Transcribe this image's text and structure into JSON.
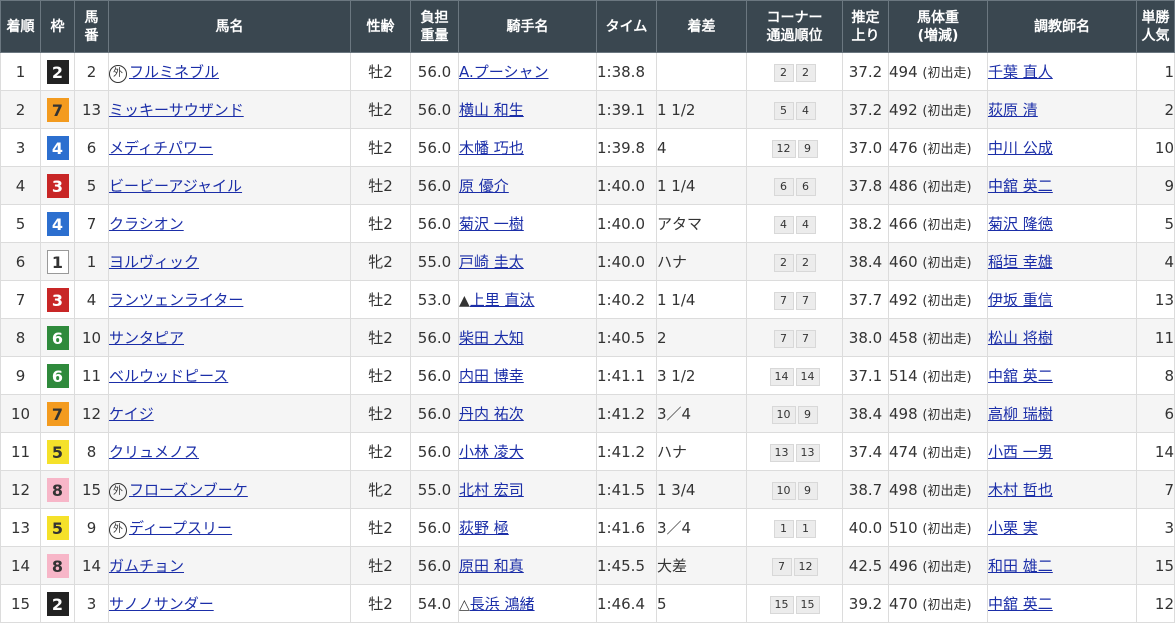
{
  "colors": {
    "header_bg": "#3a4750",
    "link": "#1b2ea8",
    "waku": {
      "1": {
        "bg": "#ffffff",
        "fg": "#333333",
        "border": "#999999"
      },
      "2": {
        "bg": "#222222",
        "fg": "#ffffff",
        "border": "#222222"
      },
      "3": {
        "bg": "#c82626",
        "fg": "#ffffff",
        "border": "#c82626"
      },
      "4": {
        "bg": "#2c6fcf",
        "fg": "#ffffff",
        "border": "#2c6fcf"
      },
      "5": {
        "bg": "#f5e12a",
        "fg": "#333333",
        "border": "#f5e12a"
      },
      "6": {
        "bg": "#2f8a3c",
        "fg": "#ffffff",
        "border": "#2f8a3c"
      },
      "7": {
        "bg": "#f39b1f",
        "fg": "#333333",
        "border": "#f39b1f"
      },
      "8": {
        "bg": "#f7b6c8",
        "fg": "#333333",
        "border": "#f7b6c8"
      }
    }
  },
  "headers": {
    "rank": "着順",
    "waku": "枠",
    "umaban": "馬\n番",
    "horse": "馬名",
    "sex_age": "性齢",
    "weight": "負担\n重量",
    "jockey": "騎手名",
    "time": "タイム",
    "margin": "着差",
    "corner": "コーナー\n通過順位",
    "last3f": "推定\n上り",
    "body_weight": "馬体重\n(増減)",
    "trainer": "調教師名",
    "popularity": "単勝\n人気"
  },
  "rows": [
    {
      "rank": "1",
      "waku": "2",
      "umaban": "2",
      "foreign": true,
      "horse": "フルミネブル",
      "sex_age": "牡2",
      "weight": "56.0",
      "jockey_mark": "",
      "jockey": "A.プーシャン",
      "time": "1:38.8",
      "margin": "",
      "corner": [
        "2",
        "2"
      ],
      "last3f": "37.2",
      "body_weight": "494",
      "weight_diff": "(初出走)",
      "trainer": "千葉 直人",
      "popularity": "1"
    },
    {
      "rank": "2",
      "waku": "7",
      "umaban": "13",
      "foreign": false,
      "horse": "ミッキーサウザンド",
      "sex_age": "牡2",
      "weight": "56.0",
      "jockey_mark": "",
      "jockey": "横山 和生",
      "time": "1:39.1",
      "margin": "1 1/2",
      "corner": [
        "5",
        "4"
      ],
      "last3f": "37.2",
      "body_weight": "492",
      "weight_diff": "(初出走)",
      "trainer": "荻原 清",
      "popularity": "2"
    },
    {
      "rank": "3",
      "waku": "4",
      "umaban": "6",
      "foreign": false,
      "horse": "メディチパワー",
      "sex_age": "牡2",
      "weight": "56.0",
      "jockey_mark": "",
      "jockey": "木幡 巧也",
      "time": "1:39.8",
      "margin": "4",
      "corner": [
        "12",
        "9"
      ],
      "last3f": "37.0",
      "body_weight": "476",
      "weight_diff": "(初出走)",
      "trainer": "中川 公成",
      "popularity": "10"
    },
    {
      "rank": "4",
      "waku": "3",
      "umaban": "5",
      "foreign": false,
      "horse": "ビービーアジャイル",
      "sex_age": "牡2",
      "weight": "56.0",
      "jockey_mark": "",
      "jockey": "原 優介",
      "time": "1:40.0",
      "margin": "1 1/4",
      "corner": [
        "6",
        "6"
      ],
      "last3f": "37.8",
      "body_weight": "486",
      "weight_diff": "(初出走)",
      "trainer": "中舘 英二",
      "popularity": "9"
    },
    {
      "rank": "5",
      "waku": "4",
      "umaban": "7",
      "foreign": false,
      "horse": "クラシオン",
      "sex_age": "牡2",
      "weight": "56.0",
      "jockey_mark": "",
      "jockey": "菊沢 一樹",
      "time": "1:40.0",
      "margin": "アタマ",
      "corner": [
        "4",
        "4"
      ],
      "last3f": "38.2",
      "body_weight": "466",
      "weight_diff": "(初出走)",
      "trainer": "菊沢 隆徳",
      "popularity": "5"
    },
    {
      "rank": "6",
      "waku": "1",
      "umaban": "1",
      "foreign": false,
      "horse": "ヨルヴィック",
      "sex_age": "牝2",
      "weight": "55.0",
      "jockey_mark": "",
      "jockey": "戸崎 圭太",
      "time": "1:40.0",
      "margin": "ハナ",
      "corner": [
        "2",
        "2"
      ],
      "last3f": "38.4",
      "body_weight": "460",
      "weight_diff": "(初出走)",
      "trainer": "稲垣 幸雄",
      "popularity": "4"
    },
    {
      "rank": "7",
      "waku": "3",
      "umaban": "4",
      "foreign": false,
      "horse": "ランツェンライター",
      "sex_age": "牡2",
      "weight": "53.0",
      "jockey_mark": "▲",
      "jockey": "上里 直汰",
      "time": "1:40.2",
      "margin": "1 1/4",
      "corner": [
        "7",
        "7"
      ],
      "last3f": "37.7",
      "body_weight": "492",
      "weight_diff": "(初出走)",
      "trainer": "伊坂 重信",
      "popularity": "13"
    },
    {
      "rank": "8",
      "waku": "6",
      "umaban": "10",
      "foreign": false,
      "horse": "サンタピア",
      "sex_age": "牡2",
      "weight": "56.0",
      "jockey_mark": "",
      "jockey": "柴田 大知",
      "time": "1:40.5",
      "margin": "2",
      "corner": [
        "7",
        "7"
      ],
      "last3f": "38.0",
      "body_weight": "458",
      "weight_diff": "(初出走)",
      "trainer": "松山 将樹",
      "popularity": "11"
    },
    {
      "rank": "9",
      "waku": "6",
      "umaban": "11",
      "foreign": false,
      "horse": "ベルウッドピース",
      "sex_age": "牡2",
      "weight": "56.0",
      "jockey_mark": "",
      "jockey": "内田 博幸",
      "time": "1:41.1",
      "margin": "3 1/2",
      "corner": [
        "14",
        "14"
      ],
      "last3f": "37.1",
      "body_weight": "514",
      "weight_diff": "(初出走)",
      "trainer": "中舘 英二",
      "popularity": "8"
    },
    {
      "rank": "10",
      "waku": "7",
      "umaban": "12",
      "foreign": false,
      "horse": "ケイジ",
      "sex_age": "牡2",
      "weight": "56.0",
      "jockey_mark": "",
      "jockey": "丹内 祐次",
      "time": "1:41.2",
      "margin": "3／4",
      "corner": [
        "10",
        "9"
      ],
      "last3f": "38.4",
      "body_weight": "498",
      "weight_diff": "(初出走)",
      "trainer": "高柳 瑞樹",
      "popularity": "6"
    },
    {
      "rank": "11",
      "waku": "5",
      "umaban": "8",
      "foreign": false,
      "horse": "クリュメノス",
      "sex_age": "牡2",
      "weight": "56.0",
      "jockey_mark": "",
      "jockey": "小林 凌大",
      "time": "1:41.2",
      "margin": "ハナ",
      "corner": [
        "13",
        "13"
      ],
      "last3f": "37.4",
      "body_weight": "474",
      "weight_diff": "(初出走)",
      "trainer": "小西 一男",
      "popularity": "14"
    },
    {
      "rank": "12",
      "waku": "8",
      "umaban": "15",
      "foreign": true,
      "horse": "フローズンブーケ",
      "sex_age": "牝2",
      "weight": "55.0",
      "jockey_mark": "",
      "jockey": "北村 宏司",
      "time": "1:41.5",
      "margin": "1 3/4",
      "corner": [
        "10",
        "9"
      ],
      "last3f": "38.7",
      "body_weight": "498",
      "weight_diff": "(初出走)",
      "trainer": "木村 哲也",
      "popularity": "7"
    },
    {
      "rank": "13",
      "waku": "5",
      "umaban": "9",
      "foreign": true,
      "horse": "ディープスリー",
      "sex_age": "牡2",
      "weight": "56.0",
      "jockey_mark": "",
      "jockey": "荻野 極",
      "time": "1:41.6",
      "margin": "3／4",
      "corner": [
        "1",
        "1"
      ],
      "last3f": "40.0",
      "body_weight": "510",
      "weight_diff": "(初出走)",
      "trainer": "小栗 実",
      "popularity": "3"
    },
    {
      "rank": "14",
      "waku": "8",
      "umaban": "14",
      "foreign": false,
      "horse": "ガムチョン",
      "sex_age": "牡2",
      "weight": "56.0",
      "jockey_mark": "",
      "jockey": "原田 和真",
      "time": "1:45.5",
      "margin": "大差",
      "corner": [
        "7",
        "12"
      ],
      "last3f": "42.5",
      "body_weight": "496",
      "weight_diff": "(初出走)",
      "trainer": "和田 雄二",
      "popularity": "15"
    },
    {
      "rank": "15",
      "waku": "2",
      "umaban": "3",
      "foreign": false,
      "horse": "サノノサンダー",
      "sex_age": "牡2",
      "weight": "54.0",
      "jockey_mark": "△",
      "jockey": "長浜 鴻緒",
      "time": "1:46.4",
      "margin": "5",
      "corner": [
        "15",
        "15"
      ],
      "last3f": "39.2",
      "body_weight": "470",
      "weight_diff": "(初出走)",
      "trainer": "中舘 英二",
      "popularity": "12"
    }
  ],
  "foreign_mark": "外"
}
